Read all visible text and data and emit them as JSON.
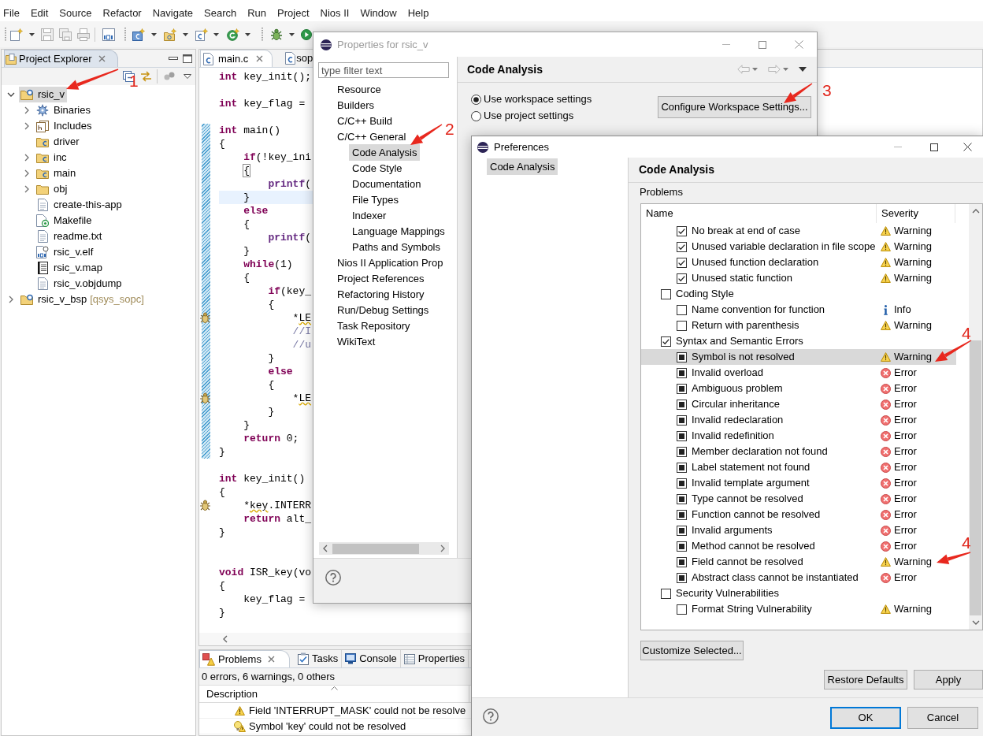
{
  "menu_bar": [
    "File",
    "Edit",
    "Source",
    "Refactor",
    "Navigate",
    "Search",
    "Run",
    "Project",
    "Nios II",
    "Window",
    "Help"
  ],
  "project_explorer": {
    "title": "Project Explorer",
    "tree": [
      {
        "label": "rsic_v",
        "kind": "project",
        "expanded": true,
        "selected": true,
        "children": [
          {
            "label": "Binaries",
            "kind": "binaries",
            "expanded": false,
            "selected": false
          },
          {
            "label": "Includes",
            "kind": "includes",
            "expanded": false,
            "selected": false
          },
          {
            "label": "driver",
            "kind": "source-folder",
            "selected": false
          },
          {
            "label": "inc",
            "kind": "source-folder",
            "expanded": false,
            "selected": false
          },
          {
            "label": "main",
            "kind": "source-folder",
            "expanded": false,
            "selected": false
          },
          {
            "label": "obj",
            "kind": "folder",
            "expanded": false,
            "selected": false
          },
          {
            "label": "create-this-app",
            "kind": "file",
            "selected": false
          },
          {
            "label": "Makefile",
            "kind": "makefile",
            "selected": false
          },
          {
            "label": "readme.txt",
            "kind": "file",
            "selected": false
          },
          {
            "label": "rsic_v.elf",
            "kind": "executable",
            "selected": false
          },
          {
            "label": "rsic_v.map",
            "kind": "map",
            "selected": false
          },
          {
            "label": "rsic_v.objdump",
            "kind": "file",
            "selected": false
          }
        ]
      },
      {
        "label": "rsic_v_bsp",
        "suffix": "[qsys_sopc]",
        "kind": "project",
        "expanded": false,
        "selected": false
      }
    ]
  },
  "editor": {
    "tabs": [
      {
        "label": "main.c",
        "selected": true
      },
      {
        "label": "sop",
        "selected": false
      }
    ],
    "lines": [
      {
        "kind": "code",
        "segments": [
          {
            "kind": "keyword",
            "text": "int"
          },
          {
            "kind": "plain",
            "text": " key_init();"
          }
        ],
        "changed": false,
        "current": false,
        "warning": false
      },
      {
        "kind": "blank"
      },
      {
        "kind": "code",
        "segments": [
          {
            "kind": "keyword",
            "text": "int"
          },
          {
            "kind": "plain",
            "text": " key_flag ="
          }
        ],
        "changed": false,
        "current": false,
        "warning": false
      },
      {
        "kind": "blank"
      },
      {
        "kind": "code",
        "segments": [
          {
            "kind": "keyword",
            "text": "int"
          },
          {
            "kind": "plain",
            "text": " main()"
          }
        ],
        "changed": true,
        "current": false,
        "warning": false
      },
      {
        "kind": "code",
        "segments": [
          {
            "kind": "plain",
            "text": "{"
          }
        ],
        "changed": true,
        "current": false,
        "warning": false
      },
      {
        "kind": "code",
        "segments": [
          {
            "kind": "keyword",
            "text": "    if"
          },
          {
            "kind": "plain",
            "text": "(!key_ini"
          }
        ],
        "changed": true,
        "current": false,
        "warning": false
      },
      {
        "kind": "code",
        "segments": [
          {
            "kind": "bracket",
            "text": "    {"
          }
        ],
        "changed": true,
        "current": false,
        "warning": false
      },
      {
        "kind": "code",
        "segments": [
          {
            "kind": "sdk-call",
            "text": "        printf"
          },
          {
            "kind": "plain",
            "text": "("
          }
        ],
        "changed": true,
        "current": false,
        "warning": false
      },
      {
        "kind": "code",
        "segments": [
          {
            "kind": "plain",
            "text": "    }"
          }
        ],
        "changed": true,
        "current": true,
        "warning": false
      },
      {
        "kind": "code",
        "segments": [
          {
            "kind": "keyword",
            "text": "    else"
          }
        ],
        "changed": true,
        "current": false,
        "warning": false
      },
      {
        "kind": "code",
        "segments": [
          {
            "kind": "plain",
            "text": "    {"
          }
        ],
        "changed": true,
        "current": false,
        "warning": false
      },
      {
        "kind": "code",
        "segments": [
          {
            "kind": "sdk-call",
            "text": "        printf"
          },
          {
            "kind": "plain",
            "text": "("
          }
        ],
        "changed": true,
        "current": false,
        "warning": false
      },
      {
        "kind": "code",
        "segments": [
          {
            "kind": "plain",
            "text": "    }"
          }
        ],
        "changed": true,
        "current": false,
        "warning": false
      },
      {
        "kind": "code",
        "segments": [
          {
            "kind": "keyword",
            "text": "    while"
          },
          {
            "kind": "plain",
            "text": "(1)"
          }
        ],
        "changed": true,
        "current": false,
        "warning": false
      },
      {
        "kind": "code",
        "segments": [
          {
            "kind": "plain",
            "text": "    {"
          }
        ],
        "changed": true,
        "current": false,
        "warning": false
      },
      {
        "kind": "code",
        "segments": [
          {
            "kind": "keyword",
            "text": "        if"
          },
          {
            "kind": "plain",
            "text": "(key_"
          }
        ],
        "changed": true,
        "current": false,
        "warning": false
      },
      {
        "kind": "code",
        "segments": [
          {
            "kind": "plain",
            "text": "        {"
          }
        ],
        "changed": true,
        "current": false,
        "warning": false
      },
      {
        "kind": "code",
        "segments": [
          {
            "kind": "plain",
            "text": "            *"
          },
          {
            "kind": "flagged",
            "text": "LE"
          }
        ],
        "changed": true,
        "current": false,
        "warning": true
      },
      {
        "kind": "code",
        "segments": [
          {
            "kind": "comment",
            "text": "            //I"
          }
        ],
        "changed": true,
        "current": false,
        "warning": false
      },
      {
        "kind": "code",
        "segments": [
          {
            "kind": "comment",
            "text": "            //u"
          }
        ],
        "changed": true,
        "current": false,
        "warning": false
      },
      {
        "kind": "code",
        "segments": [
          {
            "kind": "plain",
            "text": "        }"
          }
        ],
        "changed": true,
        "current": false,
        "warning": false
      },
      {
        "kind": "code",
        "segments": [
          {
            "kind": "keyword",
            "text": "        else"
          }
        ],
        "changed": true,
        "current": false,
        "warning": false
      },
      {
        "kind": "code",
        "segments": [
          {
            "kind": "plain",
            "text": "        {"
          }
        ],
        "changed": true,
        "current": false,
        "warning": false
      },
      {
        "kind": "code",
        "segments": [
          {
            "kind": "plain",
            "text": "            *"
          },
          {
            "kind": "flagged",
            "text": "LE"
          }
        ],
        "changed": true,
        "current": false,
        "warning": true
      },
      {
        "kind": "code",
        "segments": [
          {
            "kind": "plain",
            "text": "        }"
          }
        ],
        "changed": true,
        "current": false,
        "warning": false
      },
      {
        "kind": "code",
        "segments": [
          {
            "kind": "plain",
            "text": "    }"
          }
        ],
        "changed": true,
        "current": false,
        "warning": false
      },
      {
        "kind": "code",
        "segments": [
          {
            "kind": "keyword",
            "text": "    return"
          },
          {
            "kind": "plain",
            "text": " 0;"
          }
        ],
        "changed": true,
        "current": false,
        "warning": false
      },
      {
        "kind": "code",
        "segments": [
          {
            "kind": "plain",
            "text": "}"
          }
        ],
        "changed": true,
        "current": false,
        "warning": false
      },
      {
        "kind": "blank"
      },
      {
        "kind": "code",
        "segments": [
          {
            "kind": "keyword",
            "text": "int"
          },
          {
            "kind": "plain",
            "text": " key_init()"
          }
        ],
        "changed": false,
        "current": false,
        "warning": false
      },
      {
        "kind": "code",
        "segments": [
          {
            "kind": "plain",
            "text": "{"
          }
        ],
        "changed": false,
        "current": false,
        "warning": false
      },
      {
        "kind": "code",
        "segments": [
          {
            "kind": "plain",
            "text": "    *"
          },
          {
            "kind": "flagged",
            "text": "key"
          },
          {
            "kind": "plain",
            "text": ".INTERR"
          }
        ],
        "changed": false,
        "current": false,
        "warning": true
      },
      {
        "kind": "code",
        "segments": [
          {
            "kind": "keyword",
            "text": "    return"
          },
          {
            "kind": "plain",
            "text": " alt_"
          }
        ],
        "changed": false,
        "current": false,
        "warning": false
      },
      {
        "kind": "code",
        "segments": [
          {
            "kind": "plain",
            "text": "}"
          }
        ],
        "changed": false,
        "current": false,
        "warning": false
      },
      {
        "kind": "blank"
      },
      {
        "kind": "blank"
      },
      {
        "kind": "code",
        "segments": [
          {
            "kind": "keyword",
            "text": "void"
          },
          {
            "kind": "plain",
            "text": " ISR_key(vo"
          }
        ],
        "changed": false,
        "current": false,
        "warning": false
      },
      {
        "kind": "code",
        "segments": [
          {
            "kind": "plain",
            "text": "{"
          }
        ],
        "changed": false,
        "current": false,
        "warning": false
      },
      {
        "kind": "code",
        "segments": [
          {
            "kind": "plain",
            "text": "    key_flag ="
          }
        ],
        "changed": false,
        "current": false,
        "warning": false
      },
      {
        "kind": "code",
        "segments": [
          {
            "kind": "plain",
            "text": "}"
          }
        ],
        "changed": false,
        "current": false,
        "warning": false
      }
    ]
  },
  "problems": {
    "tabs": [
      {
        "label": "Problems",
        "kind": "problems",
        "selected": true
      },
      {
        "label": "Tasks",
        "kind": "tasks",
        "selected": false
      },
      {
        "label": "Console",
        "kind": "console",
        "selected": false
      },
      {
        "label": "Properties",
        "kind": "properties",
        "selected": false
      }
    ],
    "summary": "0 errors, 6 warnings, 0 others",
    "columns": [
      "Description"
    ],
    "rows": [
      {
        "kind": "warning",
        "description": "Field 'INTERRUPT_MASK' could not be resolve"
      },
      {
        "kind": "warning-fix",
        "description": "Symbol 'key' could not be resolved"
      }
    ]
  },
  "properties_dialog": {
    "title": "Properties for rsic_v",
    "filter": {
      "placeholder": "type filter text"
    },
    "tree": [
      {
        "label": "Resource",
        "selected": false
      },
      {
        "label": "Builders",
        "selected": false
      },
      {
        "label": "C/C++ Build",
        "selected": false
      },
      {
        "label": "C/C++ General",
        "selected": false,
        "children": [
          {
            "label": "Code Analysis",
            "selected": true
          },
          {
            "label": "Code Style",
            "selected": false
          },
          {
            "label": "Documentation",
            "selected": false
          },
          {
            "label": "File Types",
            "selected": false
          },
          {
            "label": "Indexer",
            "selected": false
          },
          {
            "label": "Language Mappings",
            "selected": false
          },
          {
            "label": "Paths and Symbols",
            "selected": false
          }
        ]
      },
      {
        "label": "Nios II Application Prop",
        "selected": false
      },
      {
        "label": "Project References",
        "selected": false
      },
      {
        "label": "Refactoring History",
        "selected": false
      },
      {
        "label": "Run/Debug Settings",
        "selected": false
      },
      {
        "label": "Task Repository",
        "selected": false
      },
      {
        "label": "WikiText",
        "selected": false
      }
    ],
    "page_title": "Code Analysis",
    "settings_scope": [
      {
        "label": "Use workspace settings",
        "selected": true
      },
      {
        "label": "Use project settings",
        "selected": false
      }
    ],
    "configure_button": "Configure Workspace Settings..."
  },
  "preferences_dialog": {
    "title": "Preferences",
    "nav": [
      {
        "label": "Code Analysis",
        "selected": true
      }
    ],
    "page_title": "Code Analysis",
    "section_label": "Problems",
    "columns": [
      "Name",
      "Severity"
    ],
    "problems": [
      {
        "children": [
          {
            "name": "No break at end of case",
            "checked": true,
            "grayed": false,
            "severity": "Warning",
            "kind": "warning",
            "selected": false
          },
          {
            "name": "Unused variable declaration in file scope",
            "checked": true,
            "grayed": false,
            "severity": "Warning",
            "kind": "warning",
            "selected": false
          },
          {
            "name": "Unused function declaration",
            "checked": true,
            "grayed": false,
            "severity": "Warning",
            "kind": "warning",
            "selected": false
          },
          {
            "name": "Unused static function",
            "checked": true,
            "grayed": false,
            "severity": "Warning",
            "kind": "warning",
            "selected": false
          }
        ]
      },
      {
        "name": "Coding Style",
        "checked": false,
        "grayed": false,
        "selected": false,
        "children": [
          {
            "name": "Name convention for function",
            "checked": false,
            "grayed": false,
            "severity": "Info",
            "kind": "info",
            "selected": false
          },
          {
            "name": "Return with parenthesis",
            "checked": false,
            "grayed": false,
            "severity": "Warning",
            "kind": "warning",
            "selected": false
          }
        ]
      },
      {
        "name": "Syntax and Semantic Errors",
        "checked": true,
        "grayed": false,
        "selected": false,
        "children": [
          {
            "name": "Symbol is not resolved",
            "checked": true,
            "grayed": true,
            "severity": "Warning",
            "kind": "warning",
            "selected": true
          },
          {
            "name": "Invalid overload",
            "checked": true,
            "grayed": true,
            "severity": "Error",
            "kind": "error",
            "selected": false
          },
          {
            "name": "Ambiguous problem",
            "checked": true,
            "grayed": true,
            "severity": "Error",
            "kind": "error",
            "selected": false
          },
          {
            "name": "Circular inheritance",
            "checked": true,
            "grayed": true,
            "severity": "Error",
            "kind": "error",
            "selected": false
          },
          {
            "name": "Invalid redeclaration",
            "checked": true,
            "grayed": true,
            "severity": "Error",
            "kind": "error",
            "selected": false
          },
          {
            "name": "Invalid redefinition",
            "checked": true,
            "grayed": true,
            "severity": "Error",
            "kind": "error",
            "selected": false
          },
          {
            "name": "Member declaration not found",
            "checked": true,
            "grayed": true,
            "severity": "Error",
            "kind": "error",
            "selected": false
          },
          {
            "name": "Label statement not found",
            "checked": true,
            "grayed": true,
            "severity": "Error",
            "kind": "error",
            "selected": false
          },
          {
            "name": "Invalid template argument",
            "checked": true,
            "grayed": true,
            "severity": "Error",
            "kind": "error",
            "selected": false
          },
          {
            "name": "Type cannot be resolved",
            "checked": true,
            "grayed": true,
            "severity": "Error",
            "kind": "error",
            "selected": false
          },
          {
            "name": "Function cannot be resolved",
            "checked": true,
            "grayed": true,
            "severity": "Error",
            "kind": "error",
            "selected": false
          },
          {
            "name": "Invalid arguments",
            "checked": true,
            "grayed": true,
            "severity": "Error",
            "kind": "error",
            "selected": false
          },
          {
            "name": "Method cannot be resolved",
            "checked": true,
            "grayed": true,
            "severity": "Error",
            "kind": "error",
            "selected": false
          },
          {
            "name": "Field cannot be resolved",
            "checked": true,
            "grayed": true,
            "severity": "Warning",
            "kind": "warning",
            "selected": false
          },
          {
            "name": "Abstract class cannot be instantiated",
            "checked": true,
            "grayed": true,
            "severity": "Error",
            "kind": "error",
            "selected": false
          }
        ]
      },
      {
        "name": "Security Vulnerabilities",
        "checked": false,
        "grayed": false,
        "selected": false,
        "children": [
          {
            "name": "Format String Vulnerability",
            "checked": false,
            "grayed": false,
            "severity": "Warning",
            "kind": "warning",
            "selected": false
          }
        ]
      }
    ],
    "customize_button": "Customize Selected...",
    "page_buttons": [
      {
        "label": "Restore Defaults"
      },
      {
        "label": "Apply"
      }
    ],
    "dialog_buttons": [
      {
        "label": "OK",
        "default": true
      },
      {
        "label": "Cancel",
        "default": false
      }
    ]
  },
  "annotations": [
    {
      "label": "1"
    },
    {
      "label": "2"
    },
    {
      "label": "3"
    },
    {
      "label": "4"
    },
    {
      "label": "4"
    }
  ]
}
